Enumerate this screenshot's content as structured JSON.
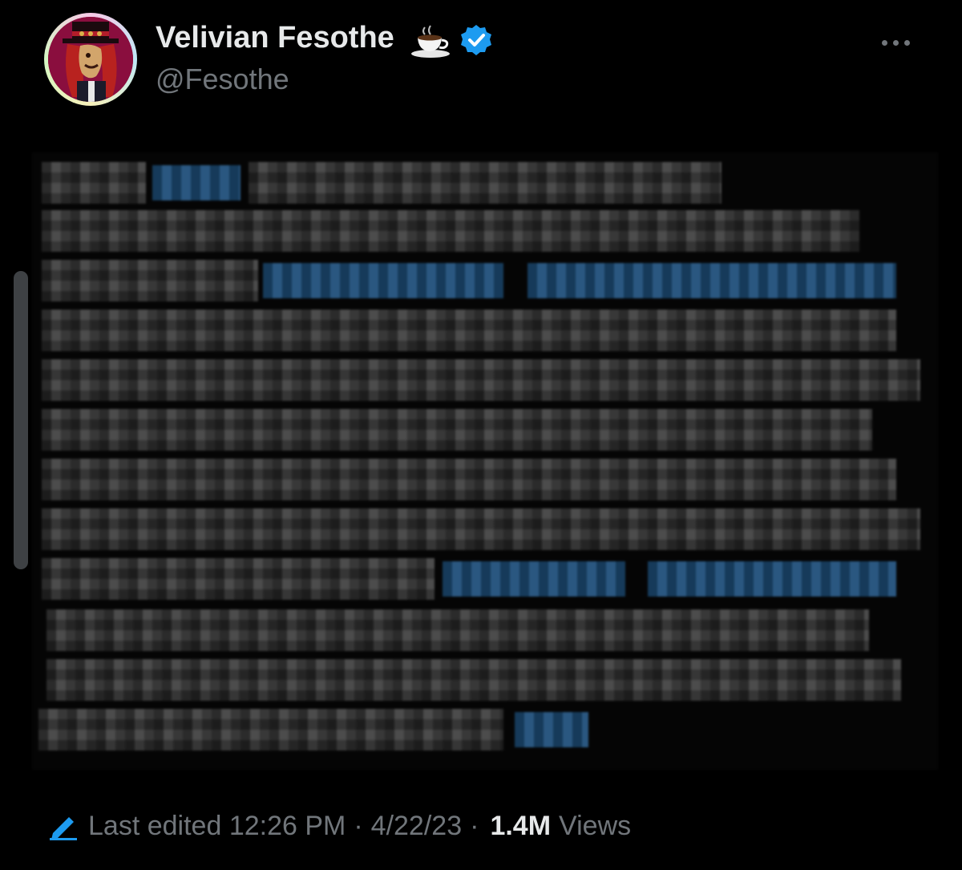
{
  "tweet": {
    "author": {
      "display_name": "Velivian Fesothe",
      "handle": "@Fesothe",
      "verified": true,
      "name_emoji_icon": "coffee-cup-icon"
    },
    "more_icon": "more-horizontal-icon",
    "body_state": "pixelated (unreadable)",
    "footer": {
      "edited_label": "Last edited",
      "time": "12:26 PM",
      "separator": "·",
      "date": "4/22/23",
      "views_count": "1.4M",
      "views_label": "Views",
      "edit_icon": "pencil-icon"
    }
  },
  "colors": {
    "background": "#000000",
    "primary_text": "#e7e9ea",
    "secondary_text": "#71767b",
    "accent_blue": "#1d9bf0",
    "link_blur": "#1d4d78"
  }
}
